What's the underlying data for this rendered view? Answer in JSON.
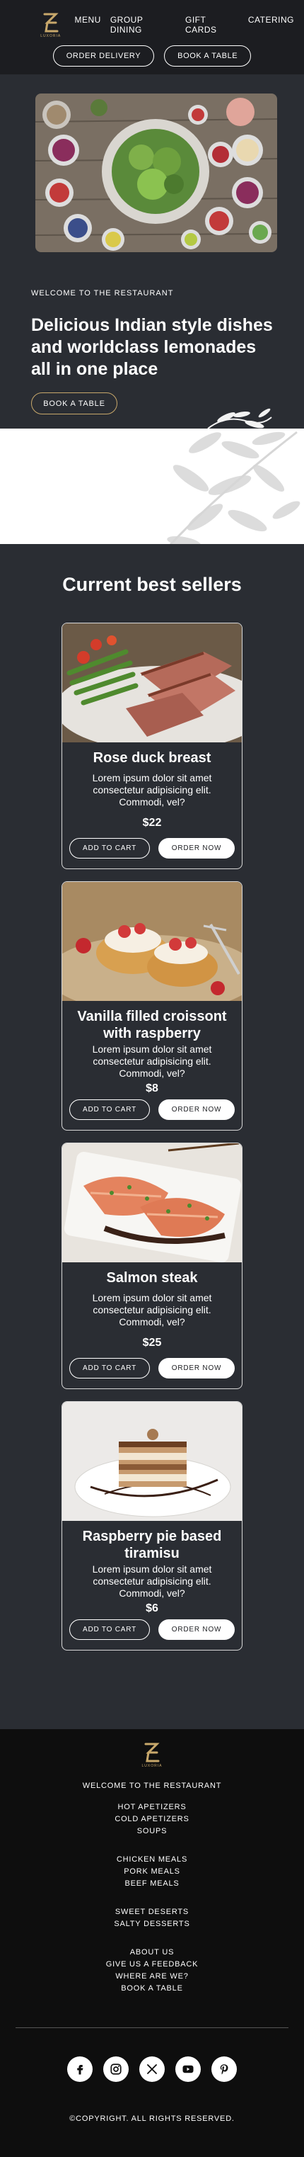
{
  "header": {
    "brand": "LUXORIA",
    "menu": [
      "MENU",
      "GROUP DINING",
      "GIFT CARDS",
      "CATERING"
    ],
    "order_delivery": "ORDER DELIVERY",
    "book_table": "BOOK A TABLE"
  },
  "hero": {
    "welcome": "WELCOME TO THE RESTAURANT",
    "title": "Delicious Indian style dishes and worldclass lemonades all in one place",
    "button": "BOOK A TABLE"
  },
  "sellers": {
    "title": "Current best sellers",
    "add_to_cart": "ADD TO CART",
    "order_now": "ORDER NOW",
    "items": [
      {
        "name": "Rose duck breast",
        "desc": "Lorem ipsum dolor sit amet consectetur adipisicing elit. Commodi, vel?",
        "price": "$22"
      },
      {
        "name": "Vanilla filled croissont with raspberry",
        "desc": "Lorem ipsum dolor sit amet consectetur adipisicing elit. Commodi, vel?",
        "price": "$8"
      },
      {
        "name": "Salmon steak",
        "desc": "Lorem ipsum dolor sit amet consectetur adipisicing elit. Commodi, vel?",
        "price": "$25"
      },
      {
        "name": "Raspberry pie based tiramisu",
        "desc": "Lorem ipsum dolor sit amet consectetur adipisicing elit. Commodi, vel?",
        "price": "$6"
      }
    ]
  },
  "footer": {
    "brand": "LUXORIA",
    "welcome": "WELCOME TO THE RESTAURANT",
    "groups": [
      [
        "HOT APETIZERS",
        "COLD APETIZERS",
        "SOUPS"
      ],
      [
        "CHICKEN MEALS",
        "PORK MEALS",
        "BEEF MEALS"
      ],
      [
        "SWEET DESERTS",
        "SALTY DESSERTS"
      ],
      [
        "ABOUT US",
        "GIVE US A FEEDBACK",
        "WHERE ARE WE?",
        "BOOK A TABLE"
      ]
    ],
    "socials": [
      "facebook-icon",
      "instagram-icon",
      "x-icon",
      "youtube-icon",
      "pinterest-icon"
    ],
    "copyright": "©COPYRIGHT. ALL RIGHTS RESERVED."
  },
  "colors": {
    "header_bg": "#1c1d21",
    "section_bg": "#2a2d33",
    "footer_bg": "#0e0e0e",
    "accent_gold": "#c8a86b"
  }
}
